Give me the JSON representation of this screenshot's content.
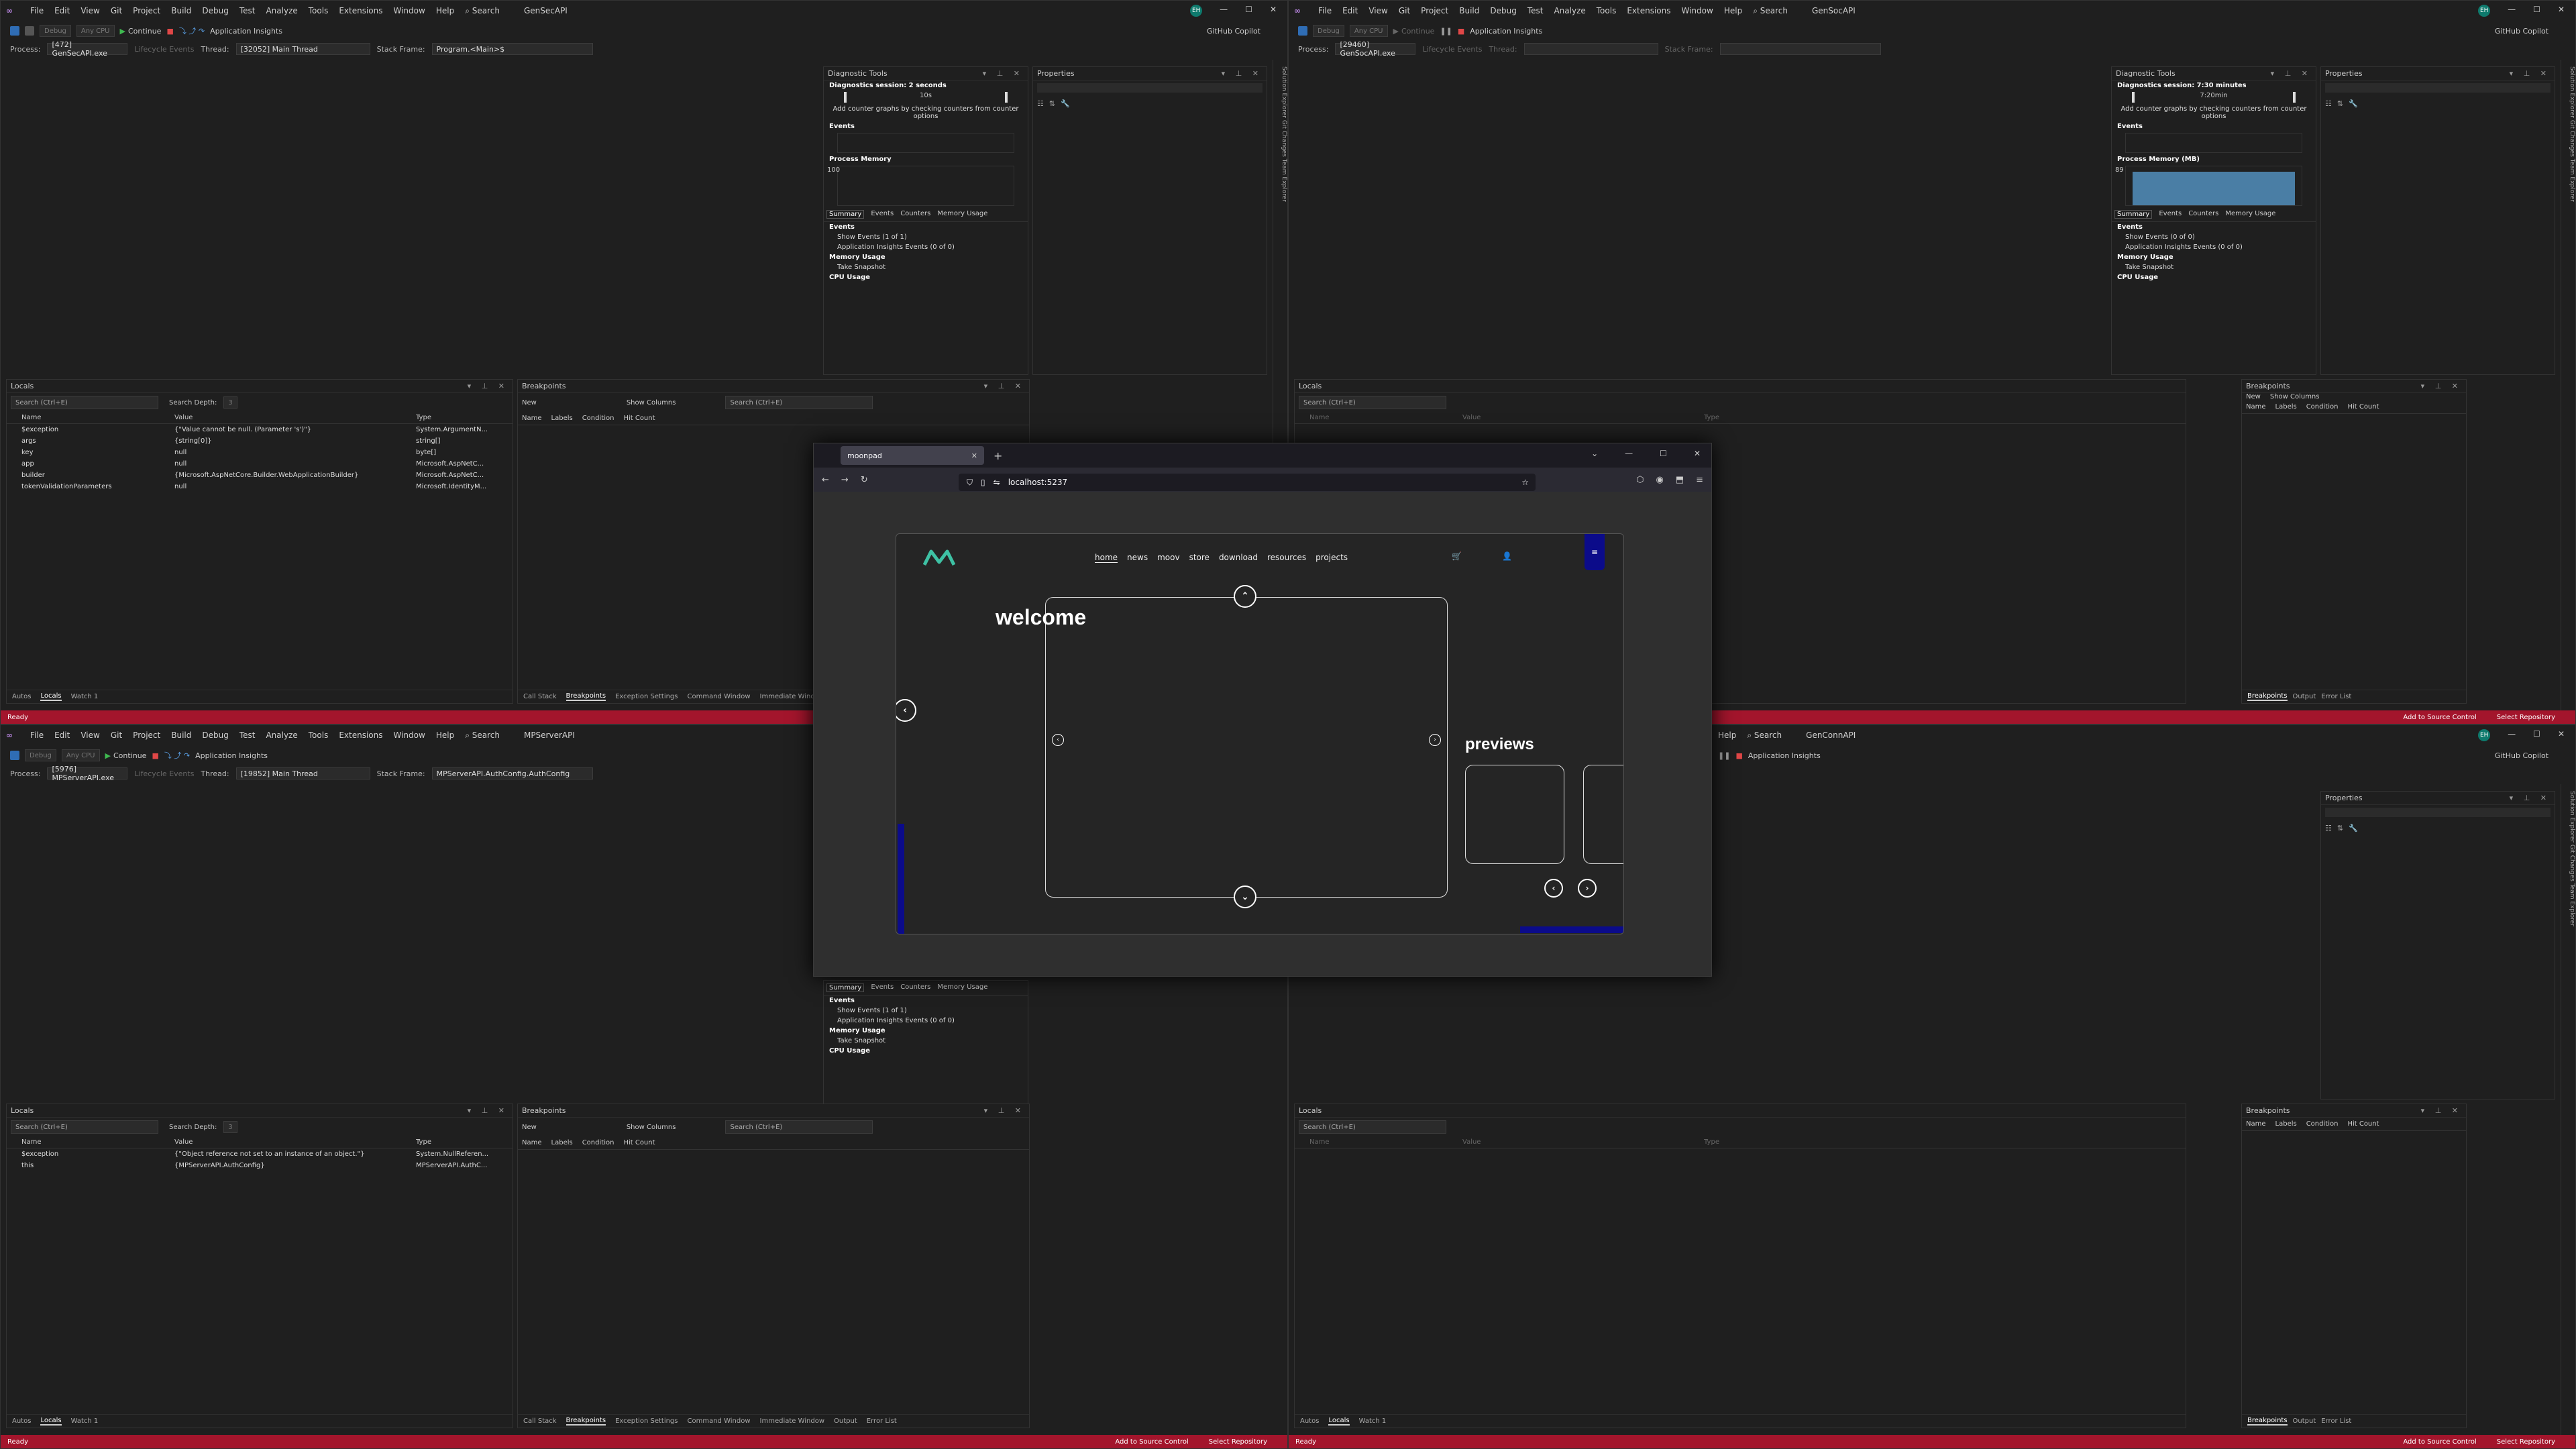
{
  "menu": [
    "File",
    "Edit",
    "View",
    "Git",
    "Project",
    "Build",
    "Debug",
    "Test",
    "Analyze",
    "Tools",
    "Extensions",
    "Window",
    "Help"
  ],
  "search_label": "Search",
  "windows": {
    "tl": {
      "title": "GenSecAPI",
      "process": "[472] GenSecAPI.exe",
      "thread": "[32052] Main Thread",
      "stack_frame": "Program.<Main>$"
    },
    "tr": {
      "title": "GenSocAPI",
      "process": "[29460] GenSocAPI.exe",
      "thread": "",
      "stack_frame": ""
    },
    "bl": {
      "title": "MPServerAPI",
      "process": "[5976] MPServerAPI.exe",
      "thread": "[19852] Main Thread",
      "stack_frame": "MPServerAPI.AuthConfig.AuthConfig"
    },
    "br": {
      "title": "GenConnAPI",
      "process": "",
      "thread": "",
      "stack_frame": ""
    }
  },
  "toolbar": {
    "continue": "Continue",
    "app_insights": "Application Insights",
    "debug": "Debug",
    "any_cpu": "Any CPU",
    "github_copilot": "GitHub Copilot"
  },
  "labels": {
    "process": "Process:",
    "lifecycle": "Lifecycle Events",
    "thread": "Thread:",
    "stack_frame": "Stack Frame:"
  },
  "locals": {
    "title": "Locals",
    "search": "Search (Ctrl+E)",
    "search_depth": "Search Depth:",
    "depth": "3",
    "headers": [
      "Name",
      "Value",
      "Type"
    ],
    "tl_rows": [
      [
        "$exception",
        "{\"Value cannot be null. (Parameter 's')\"}",
        "System.ArgumentN..."
      ],
      [
        "args",
        "{string[0]}",
        "string[]"
      ],
      [
        "key",
        "null",
        "byte[]"
      ],
      [
        "app",
        "null",
        "Microsoft.AspNetC..."
      ],
      [
        "builder",
        "{Microsoft.AspNetCore.Builder.WebApplicationBuilder}",
        "Microsoft.AspNetC..."
      ],
      [
        "tokenValidationParameters",
        "null",
        "Microsoft.IdentityM..."
      ]
    ],
    "bl_rows": [
      [
        "$exception",
        "{\"Object reference not set to an instance of an object.\"}",
        "System.NullReferen..."
      ],
      [
        "this",
        "{MPServerAPI.AuthConfig}",
        "MPServerAPI.AuthC..."
      ]
    ],
    "tabs": [
      "Autos",
      "Locals",
      "Watch 1"
    ]
  },
  "breakpoints": {
    "title": "Breakpoints",
    "new": "New",
    "show_columns": "Show Columns",
    "search": "Search (Ctrl+E)",
    "headers": [
      "Name",
      "Labels",
      "Condition",
      "Hit Count"
    ]
  },
  "bottom_tabs": [
    "Call Stack",
    "Breakpoints",
    "Exception Settings",
    "Command Window",
    "Immediate Window",
    "Output",
    "Error List"
  ],
  "diag": {
    "title": "Diagnostic Tools",
    "session_tl": "Diagnostics session: 2 seconds",
    "session_tr": "Diagnostics session: 7:30 minutes",
    "add_counter": "Add counter graphs by checking counters from counter options",
    "events": "Events",
    "process_memory": "Process Memory",
    "process_memory_mb": "Process Memory (MB)",
    "tabs": [
      "Summary",
      "Events",
      "Counters",
      "Memory Usage"
    ],
    "show_events_1": "Show Events (1 of 1)",
    "show_events_0": "Show Events (0 of 0)",
    "app_insights_events": "Application Insights Events (0 of 0)",
    "memory_usage": "Memory Usage",
    "take_snapshot": "Take Snapshot",
    "cpu_usage": "CPU Usage",
    "tl_mem_max": "100",
    "tr_mem_max": "89",
    "tl_time": "10s",
    "tr_time": "7:20min"
  },
  "properties": {
    "title": "Properties"
  },
  "side_tabs": "Solution Explorer  Git Changes  Team Explorer",
  "status": {
    "ready": "Ready",
    "add_source": "Add to Source Control",
    "select_repo": "Select Repository"
  },
  "browser": {
    "tab_title": "moonpad",
    "url": "localhost:5237",
    "nav": [
      "home",
      "news",
      "moov",
      "store",
      "download",
      "resources",
      "projects"
    ],
    "welcome": "welcome",
    "previews": "previews",
    "menu_icon": "≡",
    "accent": "#0b0b8a"
  }
}
